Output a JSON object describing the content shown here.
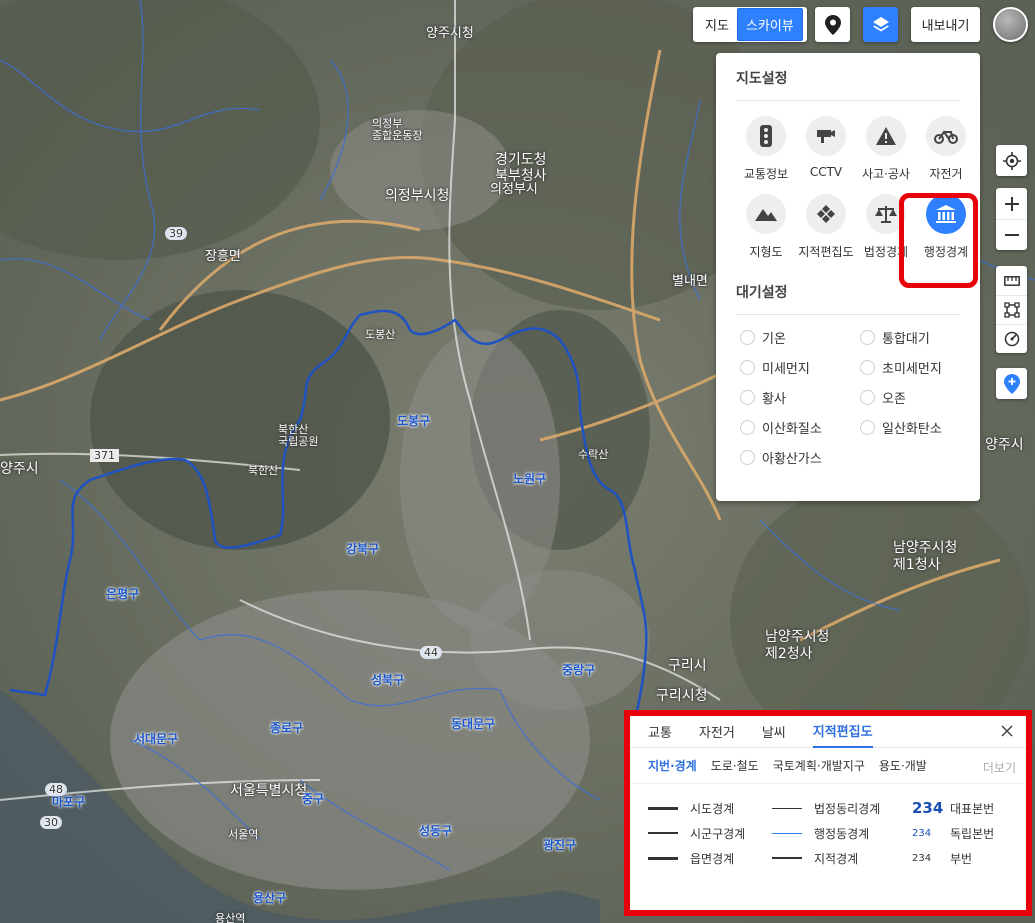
{
  "map_labels": {
    "yangju": "양주시청",
    "uijeongbu_sports": "의정부\n종합운동장",
    "gyeonggi_north": "경기도청\n북부청사",
    "uijeongbu_si": "의정부시",
    "uijeongbu_hall": "의정부시청",
    "jangheung": "장흥면",
    "byeollae": "별내면",
    "dobongsan": "도봉산",
    "dobong_gu": "도봉구",
    "bukhansan_park": "북한산\n국립공원",
    "bukhansan": "북한산",
    "nowon_gu": "노원구",
    "suraksan": "수락산",
    "gangbuk_gu": "강북구",
    "eunpyeong_gu": "은평구",
    "namyangju_1": "남양주시청\n제1청사",
    "namyangju_2": "남양주시청\n제2청사",
    "guri_si": "구리시",
    "guri_hall": "구리시청",
    "jungnang_gu": "중랑구",
    "seongbuk_gu": "성북구",
    "seodaemun_gu": "서대문구",
    "jongno_gu": "종로구",
    "dongdaemun_gu": "동대문구",
    "seoul_hall": "서울특별시청",
    "jung_gu": "중구",
    "mapo_gu": "마포구",
    "seongdong_gu": "성동구",
    "gwangjin_gu": "광진구",
    "yongsan_gu": "용산구",
    "seoul_station": "서울역",
    "yongsan_station": "용산역",
    "yangju_east": "양주시",
    "goyang_west": "양주시",
    "road_39": "39",
    "road_371": "371",
    "road_44": "44",
    "road_48": "48",
    "road_30": "30"
  },
  "toolbar": {
    "map_label": "지도",
    "skyview_label": "스카이뷰",
    "export_label": "내보내기"
  },
  "settings": {
    "map_settings_title": "지도설정",
    "icons": [
      {
        "label": "교통정보",
        "icon": "traffic-light-icon"
      },
      {
        "label": "CCTV",
        "icon": "cctv-icon"
      },
      {
        "label": "사고·공사",
        "icon": "warning-icon"
      },
      {
        "label": "자전거",
        "icon": "bicycle-icon"
      },
      {
        "label": "지형도",
        "icon": "mountain-icon"
      },
      {
        "label": "지적편집도",
        "icon": "cadastral-icon"
      },
      {
        "label": "법정경계",
        "icon": "scales-icon"
      },
      {
        "label": "행정경계",
        "icon": "government-building-icon"
      }
    ],
    "air_settings_title": "대기설정",
    "air_options": [
      "기온",
      "통합대기",
      "미세먼지",
      "초미세먼지",
      "황사",
      "오존",
      "이산화질소",
      "일산화탄소",
      "아황산가스"
    ]
  },
  "legend": {
    "tabs": [
      "교통",
      "자전거",
      "날씨",
      "지적편집도"
    ],
    "active_tab": "지적편집도",
    "subtabs": [
      "지번·경계",
      "도로·철도",
      "국토계획·개발지구",
      "용도·개발"
    ],
    "more_label": "더보기",
    "col1": [
      "시도경계",
      "시군구경계",
      "읍면경계"
    ],
    "col2": [
      "법정동리경계",
      "행정동경계",
      "지적경계"
    ],
    "num_value": "234",
    "col3": [
      "대표본번",
      "독립본번",
      "부번"
    ]
  },
  "colors": {
    "accent": "#2f80ff",
    "highlight": "#e8000a",
    "boundary": "#1f52c2"
  }
}
